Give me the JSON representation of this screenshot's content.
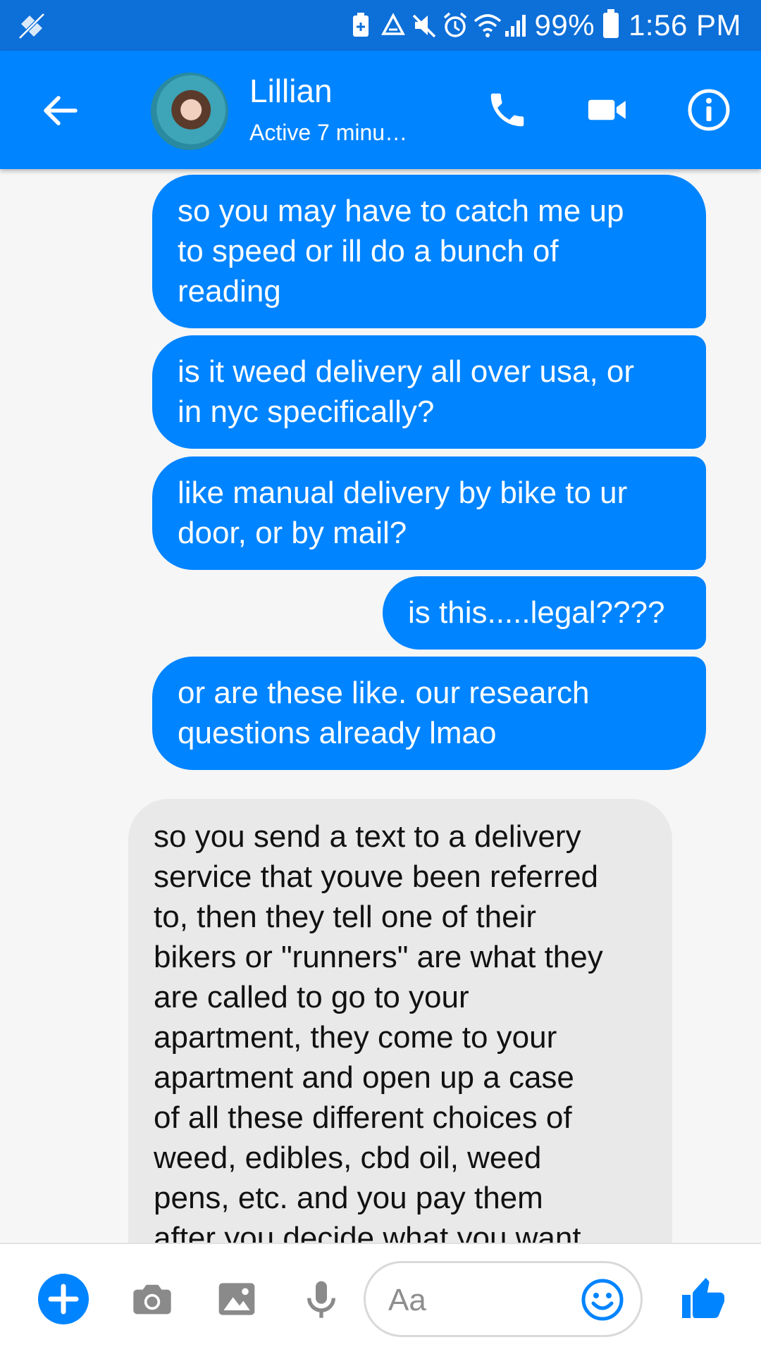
{
  "status_bar": {
    "battery_percent": "99%",
    "battery_level": 0.99,
    "time": "1:56 PM",
    "icons": [
      "no-network-icon",
      "battery-saver-icon",
      "recycle-icon",
      "mute-icon",
      "alarm-icon",
      "wifi-icon",
      "signal-icon",
      "battery-icon"
    ]
  },
  "header": {
    "contact_name": "Lillian",
    "status": "Active 7 minu…",
    "icons": [
      "back-arrow-icon",
      "phone-icon",
      "video-camera-icon",
      "info-icon"
    ]
  },
  "messages": [
    {
      "direction": "outgoing",
      "text": "so you may have to catch me up\nto speed or ill do a bunch of\nreading"
    },
    {
      "direction": "outgoing",
      "text": "is it weed delivery all over usa, or\nin nyc specifically?"
    },
    {
      "direction": "outgoing",
      "text": "like manual delivery by bike to ur\ndoor, or by mail?"
    },
    {
      "direction": "outgoing",
      "text": "is this.....legal????"
    },
    {
      "direction": "outgoing",
      "text": "or are these like. our research\nquestions already lmao"
    },
    {
      "direction": "incoming",
      "text": "so you send a text to a delivery\nservice that youve been referred\nto, then they tell one of their\nbikers or \"runners\" are what they\nare called to go to your\napartment, they come to your\napartment and open up a case\nof all these different choices of\nweed, edibles, cbd oil, weed\npens, etc. and you pay them\nafter you decide what you want"
    }
  ],
  "composer": {
    "placeholder": "Aa",
    "icons": [
      "plus-icon",
      "camera-icon",
      "image-icon",
      "microphone-icon",
      "emoji-icon",
      "thumbs-up-icon"
    ]
  },
  "colors": {
    "status_bar": "#0d6fd8",
    "header": "#0084ff",
    "outgoing_bubble": "#0084ff",
    "incoming_bubble": "#e9e9e9",
    "background": "#f6f6f6"
  }
}
